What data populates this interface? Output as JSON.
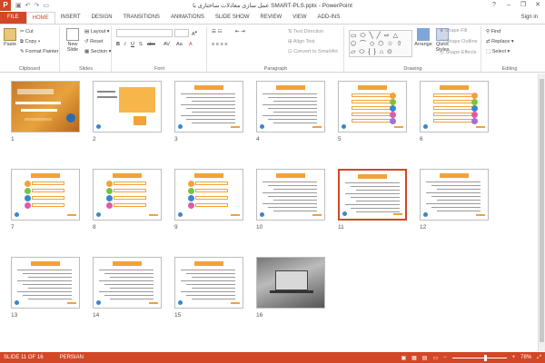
{
  "window": {
    "title": "عمل سازی معادلات ساختاری با SMART-PLS.pptx - PowerPoint",
    "sign_in": "Sign in",
    "app_logo": "P",
    "qat_icons": [
      "save-icon",
      "undo-icon",
      "redo-icon",
      "present-icon"
    ],
    "controls": [
      "?",
      "–",
      "❐",
      "✕"
    ]
  },
  "tabs": [
    "FILE",
    "HOME",
    "INSERT",
    "DESIGN",
    "TRANSITIONS",
    "ANIMATIONS",
    "SLIDE SHOW",
    "REVIEW",
    "VIEW",
    "ADD-INS"
  ],
  "active_tab": "HOME",
  "ribbon": {
    "clipboard": {
      "label": "Clipboard",
      "paste": "Paste",
      "cut": "Cut",
      "copy": "Copy",
      "format_painter": "Format Painter"
    },
    "slides": {
      "label": "Slides",
      "new_slide": "New Slide",
      "layout": "Layout",
      "reset": "Reset",
      "section": "Section"
    },
    "font": {
      "label": "Font"
    },
    "paragraph": {
      "label": "Paragraph",
      "text_direction": "Text Direction",
      "align_text": "Align Text",
      "convert_smartart": "Convert to SmartArt"
    },
    "drawing": {
      "label": "Drawing",
      "arrange": "Arrange",
      "quick_styles": "Quick Styles",
      "shape_fill": "Shape Fill",
      "shape_outline": "Shape Outline",
      "shape_effects": "Shape Effects"
    },
    "editing": {
      "label": "Editing",
      "find": "Find",
      "replace": "Replace",
      "select": "Select"
    }
  },
  "slides": [
    {
      "num": "1",
      "kind": "cover"
    },
    {
      "num": "2",
      "kind": "title2"
    },
    {
      "num": "3",
      "kind": "text"
    },
    {
      "num": "4",
      "kind": "text"
    },
    {
      "num": "5",
      "kind": "list"
    },
    {
      "num": "6",
      "kind": "list"
    },
    {
      "num": "7",
      "kind": "circles"
    },
    {
      "num": "8",
      "kind": "circles"
    },
    {
      "num": "9",
      "kind": "circles"
    },
    {
      "num": "10",
      "kind": "text"
    },
    {
      "num": "11",
      "kind": "text"
    },
    {
      "num": "12",
      "kind": "text"
    },
    {
      "num": "13",
      "kind": "text"
    },
    {
      "num": "14",
      "kind": "text"
    },
    {
      "num": "15",
      "kind": "text"
    },
    {
      "num": "16",
      "kind": "photo"
    }
  ],
  "selected_slide": "11",
  "statusbar": {
    "slide_info": "SLIDE 11 OF 16",
    "language": "PERSIAN",
    "zoom": "78%",
    "zoom_fraction": 0.62
  },
  "colors": {
    "accent": "#d24726",
    "slide_orange": "#f2a23a"
  }
}
